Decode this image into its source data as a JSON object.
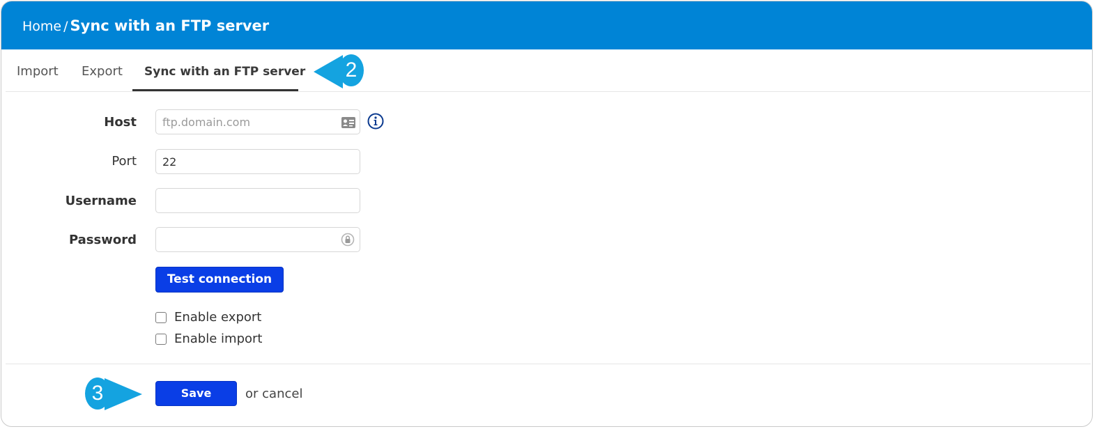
{
  "header": {
    "breadcrumb_home": "Home",
    "breadcrumb_separator": "/",
    "breadcrumb_current": "Sync with an FTP server",
    "background_color": "#0084d6"
  },
  "tabs": [
    {
      "label": "Import",
      "active": false
    },
    {
      "label": "Export",
      "active": false
    },
    {
      "label": "Sync with an FTP server",
      "active": true
    }
  ],
  "callouts": {
    "tabs_step": "2",
    "save_step": "3",
    "color": "#14a3e0"
  },
  "form": {
    "host": {
      "label": "Host",
      "value": "",
      "placeholder": "ftp.domain.com",
      "icon": "contact-card-icon"
    },
    "port": {
      "label": "Port",
      "value": "22",
      "placeholder": ""
    },
    "username": {
      "label": "Username",
      "value": "",
      "placeholder": ""
    },
    "password": {
      "label": "Password",
      "value": "",
      "placeholder": "",
      "icon": "password-manager-icon"
    },
    "info_icon": "info-icon",
    "test_connection_label": "Test connection",
    "enable_export": {
      "label": "Enable export",
      "checked": false
    },
    "enable_import": {
      "label": "Enable import",
      "checked": false
    }
  },
  "footer": {
    "save_label": "Save",
    "or_text": "or",
    "cancel_label": "cancel",
    "button_color": "#0a3ee6"
  }
}
